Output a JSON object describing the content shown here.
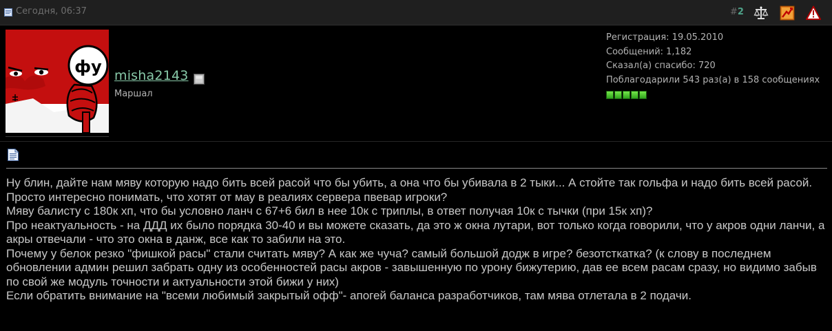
{
  "header": {
    "date": "Сегодня, 06:37",
    "post_number_prefix": "#",
    "post_number": "2",
    "icons": [
      "scales-icon",
      "reputation-icon",
      "report-icon"
    ]
  },
  "user": {
    "avatar_text": "фу",
    "username": "misha2143",
    "title": "Маршал",
    "stats": {
      "registration": "Регистрация: 19.05.2010",
      "posts": "Сообщений: 1,182",
      "thanks_given": "Сказал(а) спасибо: 720",
      "thanks_received": "Поблагодарили 543 раз(а) в 158 сообщениях"
    },
    "reputation_pips": 5
  },
  "colors": {
    "accent": "#88c9a8",
    "header_bg": "#1f1f1f",
    "avatar_red": "#c40f0f",
    "rep_green": "#4ad12a"
  },
  "post": {
    "lines": [
      "Ну блин, дайте нам мяву которую надо бить всей расой что бы убить, а она что бы убивала в 2 тыки... А стойте так гольфа и надо бить всей расой.",
      "Просто интересно понимать, что хотят от мау в реалиях сервера пвевар игроки?",
      "Мяву балисту с 180к хп, что бы условно ланч с 67+6 бил в нее 10к с триплы, в ответ получая 10к с тычки (при 15к хп)?",
      "Про неактуальность - на ДДД их было порядка 30-40 и вы можете сказать, да это ж окна лутари, вот только когда говорили, что у акров одни ланчи, а акры отвечали - что это окна в данж, все как то забили на это.",
      "Почему у белок резко \"фишкой расы\" стали считать мяву? А как же чуча? самый большой додж в игре? безотсткатка? (к слову в последнем обновлении админ решил забрать одну из особенностей расы акров - завышенную по урону бижутерию, дав ее всем расам сразу, но видимо забыв по свой же модуль точности и актуальности этой бижи у них)",
      "Если обратить внимание на \"всеми любимый закрытый офф\"- апогей баланса разработчиков, там мява отлетала в 2 подачи."
    ]
  }
}
